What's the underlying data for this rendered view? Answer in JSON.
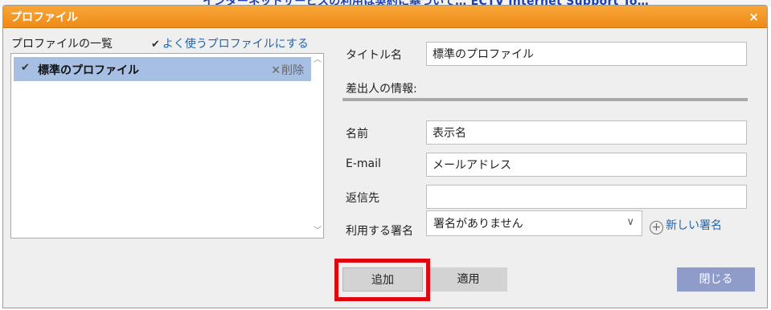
{
  "background": {
    "link_text": "インターネットサービスの利用は契約に基づいて… ECTV Internet Support To…"
  },
  "dialog": {
    "title": "プロファイル",
    "close_glyph": "×"
  },
  "left_panel": {
    "header": "プロファイルの一覧",
    "favorite_label": "よく使うプロファイルにする",
    "profiles": [
      {
        "name": "標準のプロファイル",
        "delete_label": "削除",
        "selected": true
      }
    ]
  },
  "form": {
    "title_label": "タイトル名",
    "title_value": "標準のプロファイル",
    "sender_section": "差出人の情報:",
    "name_label": "名前",
    "name_value": "表示名",
    "email_label": "E-mail",
    "email_value": "メールアドレス",
    "reply_label": "返信先",
    "reply_value": "",
    "signature_label": "利用する署名",
    "signature_value": "署名がありません",
    "new_signature_label": "新しい署名"
  },
  "buttons": {
    "add": "追加",
    "apply": "適用",
    "close": "閉じる"
  },
  "colors": {
    "titlebar": "#f19a25",
    "selection": "#a6bfe2",
    "link": "#2265a8",
    "close_button": "#8f9bc9",
    "highlight": "#e3060d"
  }
}
